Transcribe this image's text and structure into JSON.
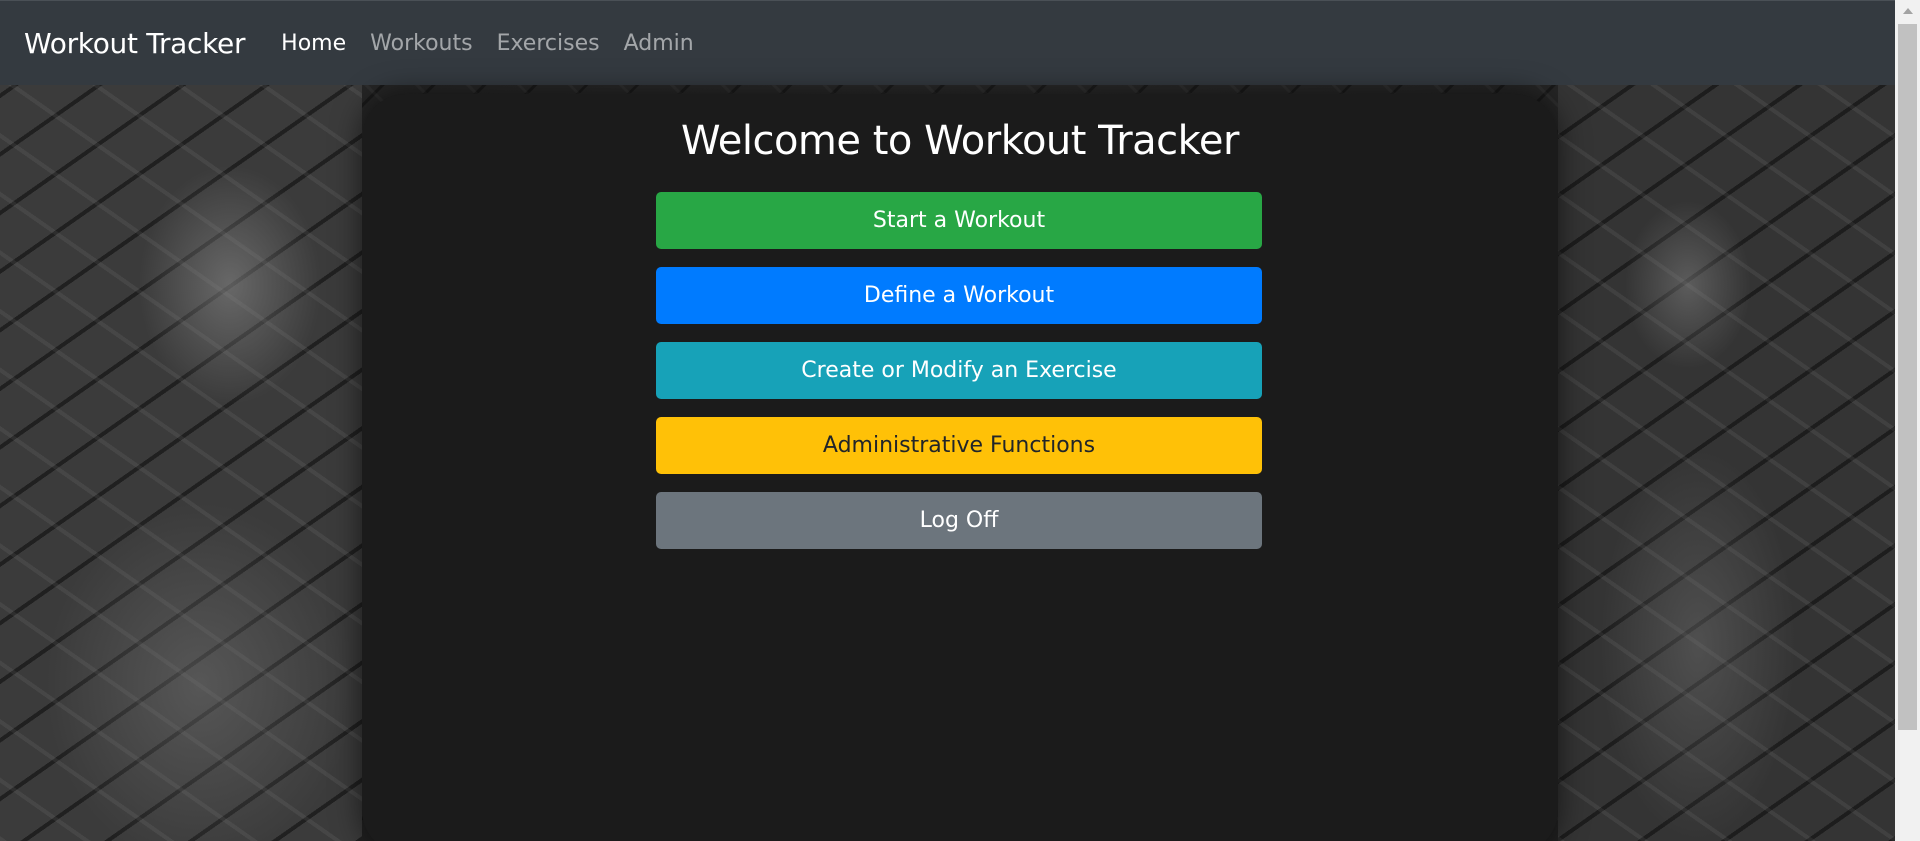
{
  "navbar": {
    "brand": "Workout Tracker",
    "links": [
      {
        "label": "Home",
        "active": true
      },
      {
        "label": "Workouts",
        "active": false
      },
      {
        "label": "Exercises",
        "active": false
      },
      {
        "label": "Admin",
        "active": false
      }
    ]
  },
  "main": {
    "title": "Welcome to Workout Tracker",
    "buttons": [
      {
        "label": "Start a Workout",
        "color": "#28a745"
      },
      {
        "label": "Define a Workout",
        "color": "#007bff"
      },
      {
        "label": "Create or Modify an Exercise",
        "color": "#17a2b8"
      },
      {
        "label": "Administrative Functions",
        "color": "#ffc107"
      },
      {
        "label": "Log Off",
        "color": "#6c757d"
      }
    ]
  },
  "colors": {
    "navbar_bg": "#343a40",
    "panel_bg": "#1b1b1b"
  }
}
